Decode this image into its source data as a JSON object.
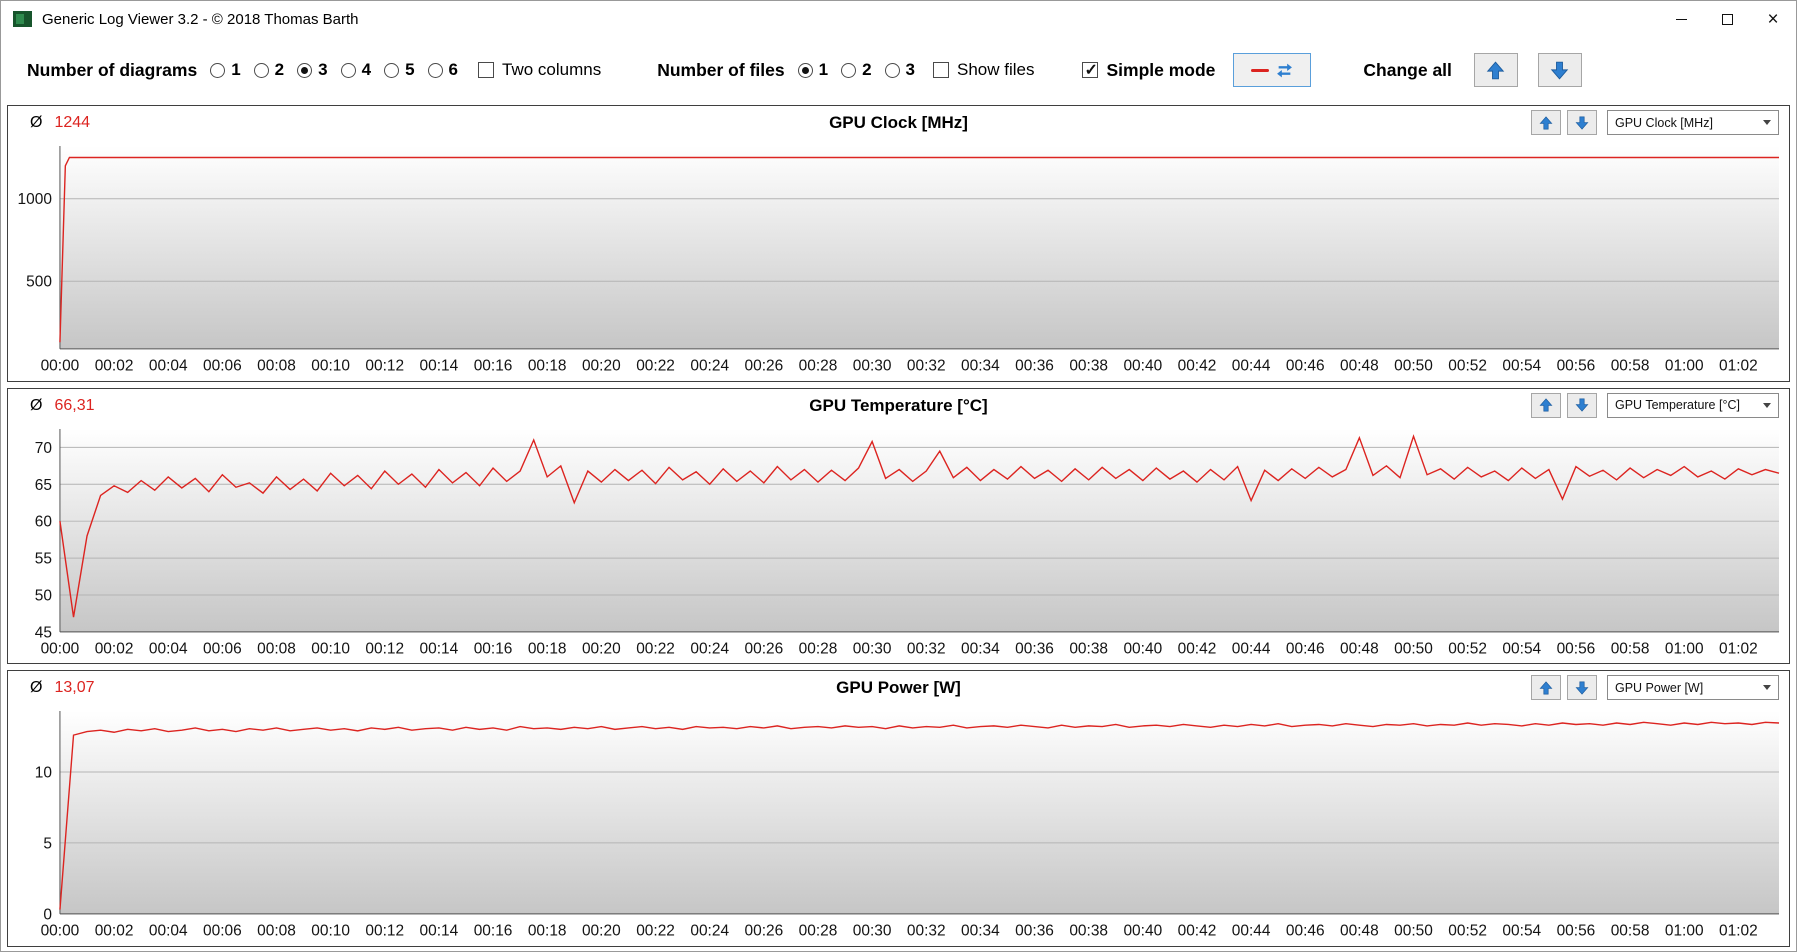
{
  "window": {
    "title": "Generic Log Viewer 3.2 - © 2018 Thomas Barth",
    "close_glyph": "×"
  },
  "toolbar": {
    "diagrams_label": "Number of diagrams",
    "diagram_options": [
      "1",
      "2",
      "3",
      "4",
      "5",
      "6"
    ],
    "diagrams_selected": "3",
    "two_columns_label": "Two columns",
    "two_columns_checked": false,
    "files_label": "Number of files",
    "file_options": [
      "1",
      "2",
      "3"
    ],
    "files_selected": "1",
    "show_files_label": "Show files",
    "show_files_checked": false,
    "simple_mode_label": "Simple mode",
    "simple_mode_checked": true,
    "change_all_label": "Change all"
  },
  "panels": [
    {
      "avg_symbol": "Ø",
      "avg_value": "1244",
      "title": "GPU Clock [MHz]",
      "dropdown_value": "GPU Clock [MHz]"
    },
    {
      "avg_symbol": "Ø",
      "avg_value": "66,31",
      "title": "GPU Temperature [°C]",
      "dropdown_value": "GPU Temperature [°C]"
    },
    {
      "avg_symbol": "Ø",
      "avg_value": "13,07",
      "title": "GPU Power [W]",
      "dropdown_value": "GPU Power [W]"
    }
  ],
  "colors": {
    "series_red": "#dc2420",
    "accent_blue": "#2e7fd0",
    "plot_gradient_top": "#ffffff",
    "plot_gradient_bottom": "#c6c6c6",
    "grid": "#b4b4b4",
    "axis": "#555555"
  },
  "chart_data": [
    {
      "type": "line",
      "title": "GPU Clock [MHz]",
      "average": 1244,
      "color": "#dc2420",
      "ylim": [
        90,
        1320
      ],
      "yticks": [
        500,
        1000
      ],
      "x_end": 63.5,
      "x_tick_step": 2,
      "x_tick_labels": [
        "00:00",
        "00:02",
        "00:04",
        "00:06",
        "00:08",
        "00:10",
        "00:12",
        "00:14",
        "00:16",
        "00:18",
        "00:20",
        "00:22",
        "00:24",
        "00:26",
        "00:28",
        "00:30",
        "00:32",
        "00:34",
        "00:36",
        "00:38",
        "00:40",
        "00:42",
        "00:44",
        "00:46",
        "00:48",
        "00:50",
        "00:52",
        "00:54",
        "00:56",
        "00:58",
        "01:00",
        "01:02"
      ],
      "x": [
        0,
        0.2,
        0.35,
        63.5
      ],
      "y": [
        130,
        1200,
        1250,
        1250
      ]
    },
    {
      "type": "line",
      "title": "GPU Temperature [°C]",
      "average": 66.31,
      "color": "#dc2420",
      "ylim": [
        45,
        72.5
      ],
      "yticks": [
        45,
        50,
        55,
        60,
        65,
        70
      ],
      "x_end": 63.5,
      "x_tick_step": 2,
      "x_tick_labels": [
        "00:00",
        "00:02",
        "00:04",
        "00:06",
        "00:08",
        "00:10",
        "00:12",
        "00:14",
        "00:16",
        "00:18",
        "00:20",
        "00:22",
        "00:24",
        "00:26",
        "00:28",
        "00:30",
        "00:32",
        "00:34",
        "00:36",
        "00:38",
        "00:40",
        "00:42",
        "00:44",
        "00:46",
        "00:48",
        "00:50",
        "00:52",
        "00:54",
        "00:56",
        "00:58",
        "01:00",
        "01:02"
      ],
      "y": [
        60.0,
        47.0,
        58.0,
        63.5,
        64.8,
        63.9,
        65.5,
        64.2,
        66.0,
        64.5,
        65.8,
        64.0,
        66.3,
        64.6,
        65.2,
        63.8,
        66.0,
        64.3,
        65.7,
        64.1,
        66.5,
        64.8,
        66.2,
        64.4,
        66.8,
        65.0,
        66.4,
        64.6,
        67.0,
        65.2,
        66.6,
        64.8,
        67.2,
        65.4,
        66.8,
        71.0,
        66.0,
        67.5,
        62.5,
        66.8,
        65.3,
        67.0,
        65.5,
        66.9,
        65.1,
        67.3,
        65.6,
        66.7,
        65.0,
        67.1,
        65.4,
        66.8,
        65.2,
        67.4,
        65.6,
        67.0,
        65.3,
        66.9,
        65.5,
        67.2,
        70.8,
        65.8,
        67.0,
        65.4,
        66.8,
        69.5,
        65.9,
        67.3,
        65.5,
        67.0,
        65.7,
        67.4,
        65.8,
        66.9,
        65.4,
        67.1,
        65.6,
        67.3,
        65.8,
        67.0,
        65.5,
        67.2,
        65.7,
        66.8,
        65.3,
        67.0,
        65.6,
        67.4,
        62.8,
        66.9,
        65.5,
        67.1,
        65.8,
        67.3,
        66.0,
        67.0,
        71.3,
        66.2,
        67.5,
        65.9,
        71.5,
        66.3,
        67.1,
        65.7,
        67.3,
        66.0,
        66.8,
        65.5,
        67.2,
        65.8,
        67.0,
        63.0,
        67.4,
        66.1,
        66.9,
        65.6,
        67.2,
        65.9,
        67.0,
        66.2,
        67.4,
        66.0,
        66.8,
        65.7,
        67.1,
        66.3,
        67.0,
        66.5
      ]
    },
    {
      "type": "line",
      "title": "GPU Power [W]",
      "average": 13.07,
      "color": "#dc2420",
      "ylim": [
        0,
        14.3
      ],
      "yticks": [
        0,
        5,
        10
      ],
      "x_end": 63.5,
      "x_tick_step": 2,
      "x_tick_labels": [
        "00:00",
        "00:02",
        "00:04",
        "00:06",
        "00:08",
        "00:10",
        "00:12",
        "00:14",
        "00:16",
        "00:18",
        "00:20",
        "00:22",
        "00:24",
        "00:26",
        "00:28",
        "00:30",
        "00:32",
        "00:34",
        "00:36",
        "00:38",
        "00:40",
        "00:42",
        "00:44",
        "00:46",
        "00:48",
        "00:50",
        "00:52",
        "00:54",
        "00:56",
        "00:58",
        "01:00",
        "01:02"
      ],
      "y": [
        0.3,
        12.6,
        12.85,
        12.95,
        12.8,
        13.0,
        12.9,
        13.05,
        12.85,
        12.95,
        13.1,
        12.9,
        13.0,
        12.85,
        13.05,
        12.95,
        13.1,
        12.9,
        13.0,
        13.1,
        12.95,
        13.05,
        12.9,
        13.1,
        13.0,
        13.15,
        12.95,
        13.05,
        13.1,
        12.95,
        13.15,
        13.0,
        13.1,
        12.95,
        13.2,
        13.05,
        13.1,
        13.0,
        13.15,
        13.05,
        13.2,
        13.0,
        13.1,
        13.2,
        13.05,
        13.15,
        13.0,
        13.2,
        13.1,
        13.15,
        13.05,
        13.2,
        13.1,
        13.25,
        13.05,
        13.15,
        13.2,
        13.1,
        13.25,
        13.15,
        13.2,
        13.05,
        13.25,
        13.1,
        13.2,
        13.15,
        13.3,
        13.1,
        13.2,
        13.25,
        13.15,
        13.3,
        13.2,
        13.1,
        13.3,
        13.15,
        13.25,
        13.2,
        13.35,
        13.15,
        13.25,
        13.3,
        13.2,
        13.35,
        13.25,
        13.15,
        13.3,
        13.2,
        13.35,
        13.25,
        13.4,
        13.2,
        13.3,
        13.35,
        13.25,
        13.4,
        13.3,
        13.2,
        13.35,
        13.3,
        13.4,
        13.25,
        13.35,
        13.3,
        13.45,
        13.3,
        13.4,
        13.35,
        13.25,
        13.4,
        13.3,
        13.45,
        13.35,
        13.4,
        13.3,
        13.45,
        13.35,
        13.5,
        13.4,
        13.3,
        13.45,
        13.35,
        13.5,
        13.4,
        13.45,
        13.35,
        13.5,
        13.45
      ]
    }
  ]
}
